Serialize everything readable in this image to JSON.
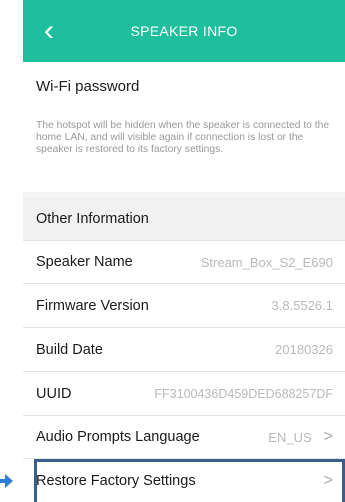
{
  "header": {
    "title": "SPEAKER INFO",
    "back_icon": "chevron-left-icon"
  },
  "wifi": {
    "title": "Wi-Fi password",
    "description": "The hotspot will be hidden when the speaker is connected to the home LAN, and will visible again if connection is lost or the speaker is restored to its factory settings."
  },
  "section": {
    "title": "Other Information"
  },
  "rows": [
    {
      "label": "Speaker Name",
      "value": "Stream_Box_S2_E690"
    },
    {
      "label": "Firmware Version",
      "value": "3.8.5526.1"
    },
    {
      "label": "Build Date",
      "value": "20180326"
    },
    {
      "label": "UUID",
      "value": "FF3100436D459DED688257DF"
    },
    {
      "label": "Audio Prompts Language",
      "value": "EN_US",
      "chevron": ">"
    },
    {
      "label": "Restore Factory Settings",
      "chevron": ">"
    }
  ],
  "colors": {
    "accent": "#1fbf9e",
    "highlight_border": "#3a5f8f",
    "arrow": "#2e7fd1"
  }
}
